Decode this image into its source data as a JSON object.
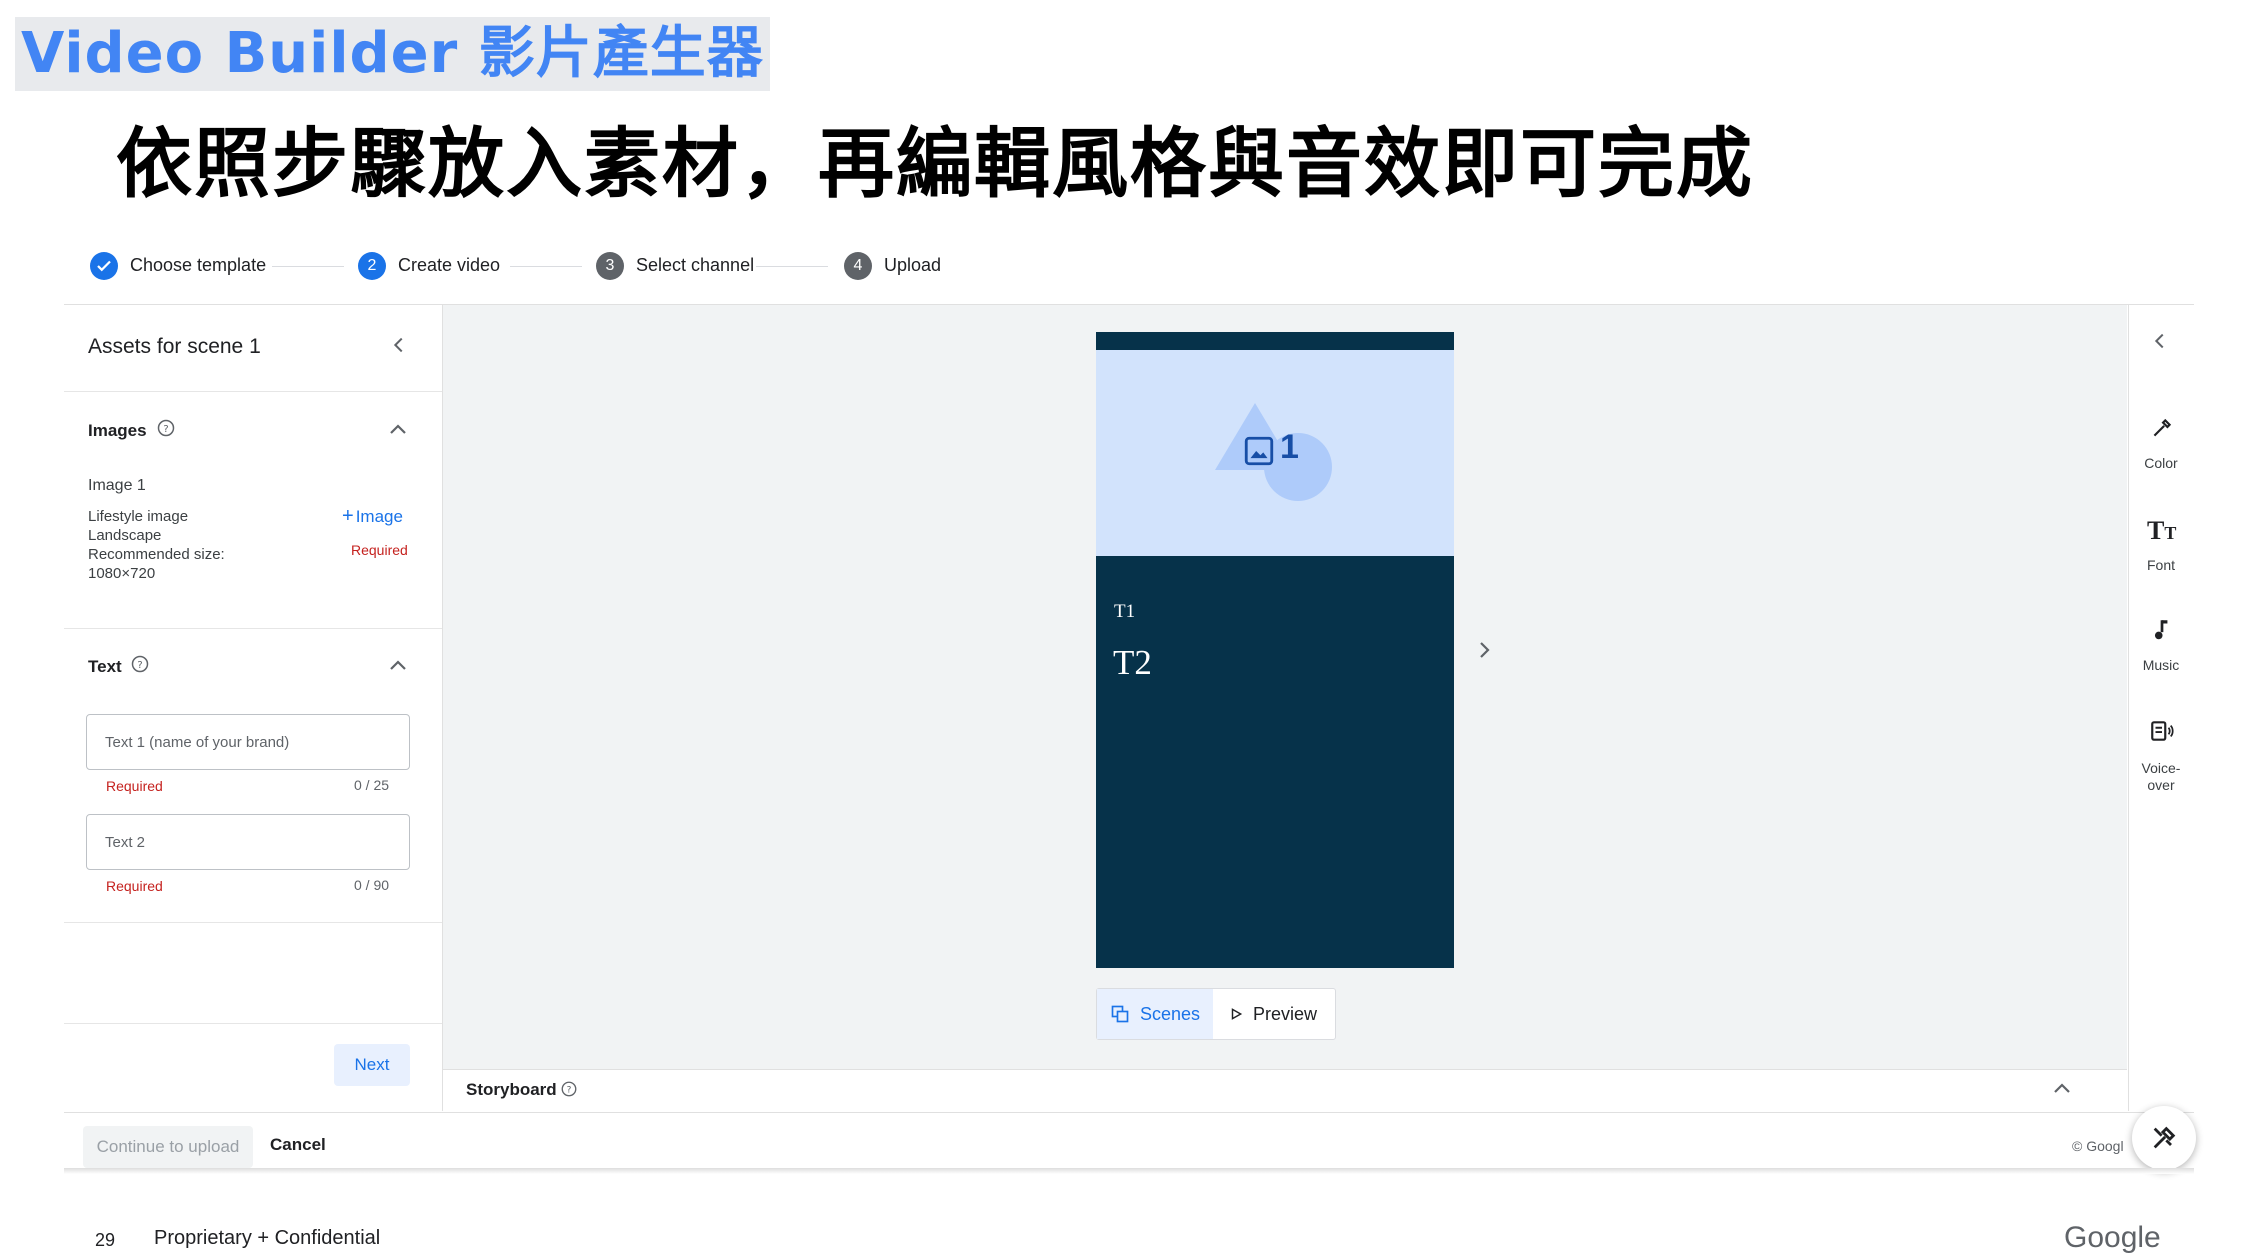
{
  "slide": {
    "tag": "Video Builder 影片產生器",
    "headline": "依照步驟放入素材，再編輯風格與音效即可完成"
  },
  "stepper": {
    "steps": [
      {
        "number": "",
        "label": "Choose template",
        "state": "done"
      },
      {
        "number": "2",
        "label": "Create video",
        "state": "active"
      },
      {
        "number": "3",
        "label": "Select channel",
        "state": "pending"
      },
      {
        "number": "4",
        "label": "Upload",
        "state": "pending"
      }
    ]
  },
  "left_panel": {
    "title": "Assets for scene 1",
    "images_section": {
      "heading": "Images",
      "item_title": "Image 1",
      "details": [
        "Lifestyle image",
        "Landscape",
        "Recommended size:",
        "1080×720"
      ],
      "add_label": "Image",
      "required": "Required"
    },
    "text_section": {
      "heading": "Text",
      "fields": [
        {
          "placeholder": "Text 1 (name of your brand)",
          "required": "Required",
          "counter": "0 / 25"
        },
        {
          "placeholder": "Text 2",
          "required": "Required",
          "counter": "0 / 90"
        }
      ]
    },
    "next_label": "Next"
  },
  "preview": {
    "image_slot": "1",
    "t1": "T1",
    "t2": "T2",
    "tabs": {
      "scenes": "Scenes",
      "preview": "Preview"
    }
  },
  "storyboard": {
    "label": "Storyboard"
  },
  "right_rail": {
    "items": [
      {
        "label": "Color",
        "icon": "eyedropper-icon"
      },
      {
        "label": "Font",
        "icon": "text-size-icon"
      },
      {
        "label": "Music",
        "icon": "music-note-icon"
      },
      {
        "label": [
          "Voice-",
          "over"
        ],
        "icon": "voiceover-icon"
      }
    ]
  },
  "bottom_bar": {
    "continue_label": "Continue to upload",
    "cancel_label": "Cancel",
    "copyright": "© Googl"
  },
  "footer": {
    "page_number": "29",
    "confidential": "Proprietary + Confidential",
    "brand": "Google"
  },
  "colors": {
    "accent": "#1a73e8",
    "preview_dark": "#06324a",
    "preview_light": "#d2e3fc",
    "required": "#c5221f"
  }
}
